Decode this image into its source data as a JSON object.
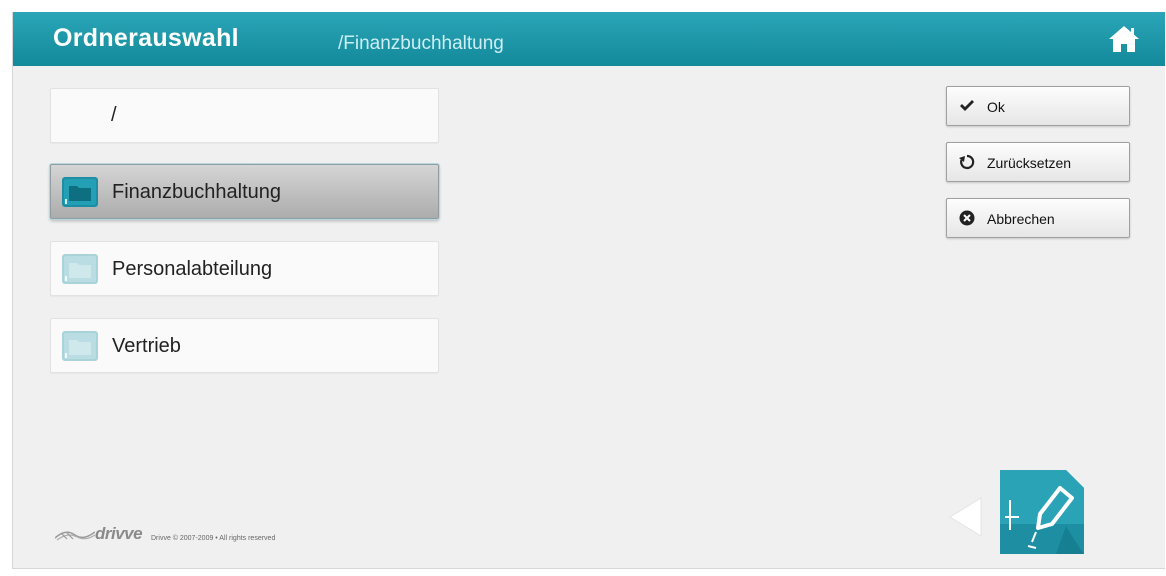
{
  "header": {
    "title": "Ordnerauswahl",
    "path": "/Finanzbuchhaltung",
    "home_icon": "home-icon"
  },
  "folders": {
    "root": {
      "label": "/"
    },
    "items": [
      {
        "label": "Finanzbuchhaltung",
        "selected": true,
        "icon": "folder-icon"
      },
      {
        "label": "Personalabteilung",
        "selected": false,
        "icon": "folder-icon"
      },
      {
        "label": "Vertrieb",
        "selected": false,
        "icon": "folder-icon"
      }
    ]
  },
  "actions": {
    "ok": {
      "label": "Ok",
      "icon": "check-icon"
    },
    "reset": {
      "label": "Zurücksetzen",
      "icon": "reset-icon"
    },
    "cancel": {
      "label": "Abbrechen",
      "icon": "cancel-icon"
    }
  },
  "footer": {
    "brand": "drivve",
    "copyright": "Drivve © 2007-2009 • All rights reserved"
  },
  "colors": {
    "header": "#1b96a8",
    "folder_active": "#1e8fa3",
    "folder_inactive": "#a9d3d9",
    "background": "#f0f0f0"
  },
  "icons": {
    "back": "back-arrow-icon",
    "edit": "edit-document-icon"
  }
}
